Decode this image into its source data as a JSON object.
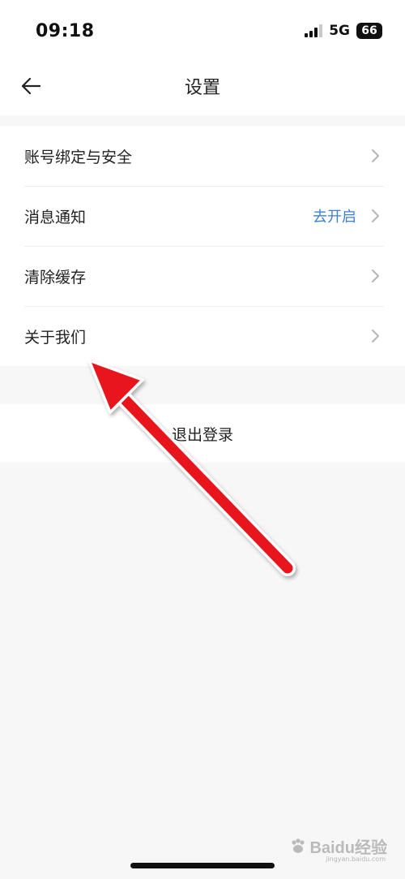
{
  "status_bar": {
    "time": "09:18",
    "network": "5G",
    "battery": "66"
  },
  "nav": {
    "title": "设置"
  },
  "settings": {
    "items": [
      {
        "label": "账号绑定与安全",
        "value": ""
      },
      {
        "label": "消息通知",
        "value": "去开启"
      },
      {
        "label": "清除缓存",
        "value": ""
      },
      {
        "label": "关于我们",
        "value": ""
      }
    ]
  },
  "logout": {
    "label": "退出登录"
  },
  "watermark": {
    "text": "Baidu经验",
    "sub": "jingyan.baidu.com"
  },
  "colors": {
    "accent": "#3d7fd6",
    "annotation_arrow": "#e8151b",
    "background": "#f7f7f7"
  }
}
